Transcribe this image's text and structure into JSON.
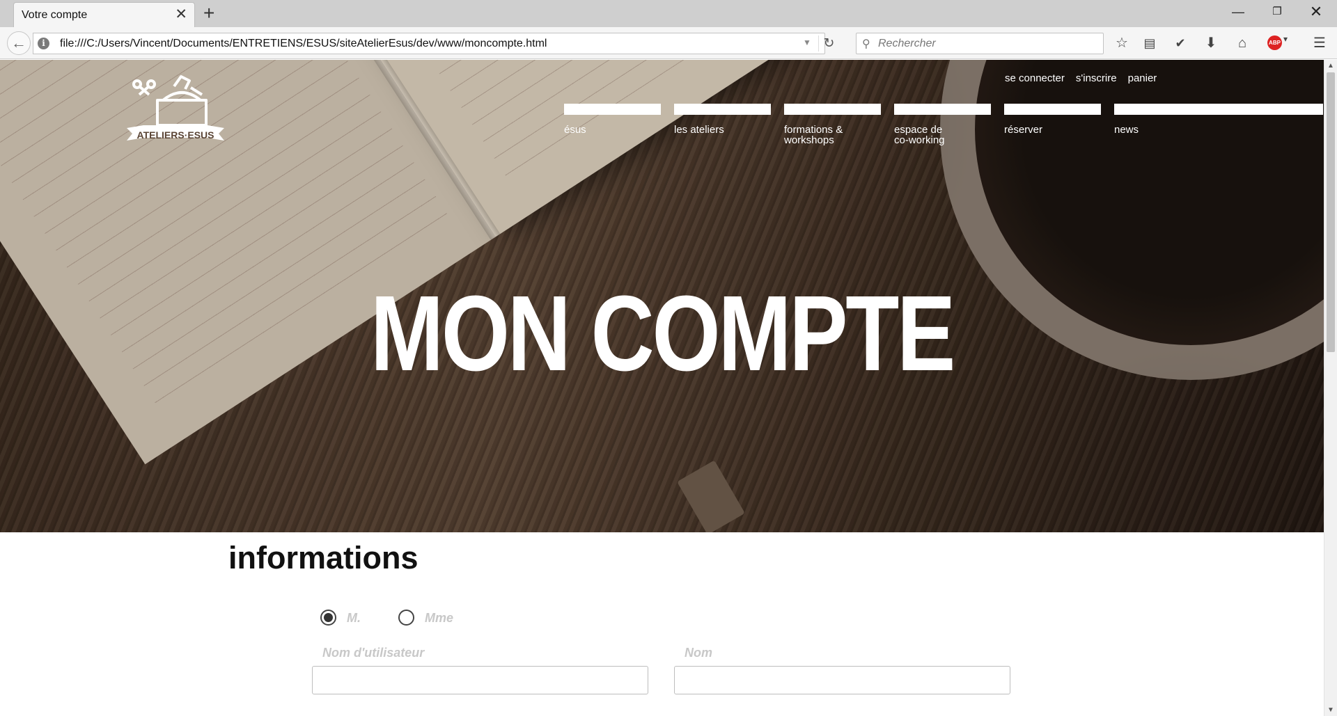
{
  "browser": {
    "tab_title": "Votre compte",
    "tab_close": "✕",
    "new_tab": "+",
    "url": "file:///C:/Users/Vincent/Documents/ENTRETIENS/ESUS/siteAtelierEsus/dev/www/moncompte.html",
    "search_placeholder": "Rechercher",
    "abp_label": "ABP"
  },
  "header": {
    "logo_text": "ATELIERS·ESUS",
    "top_links": [
      "se connecter",
      "s'inscrire",
      "panier"
    ],
    "nav": [
      {
        "label": "ésus"
      },
      {
        "label": "les ateliers"
      },
      {
        "label": "formations &\nworkshops"
      },
      {
        "label": "espace de\nco-working"
      },
      {
        "label": "réserver"
      },
      {
        "label": "news"
      }
    ]
  },
  "hero": {
    "title": "MON COMPTE"
  },
  "form": {
    "section_title": "informations",
    "civility": [
      {
        "label": "M.",
        "checked": true
      },
      {
        "label": "Mme",
        "checked": false
      }
    ],
    "fields": [
      {
        "label": "Nom d'utilisateur",
        "value": ""
      },
      {
        "label": "Nom",
        "value": ""
      }
    ]
  }
}
